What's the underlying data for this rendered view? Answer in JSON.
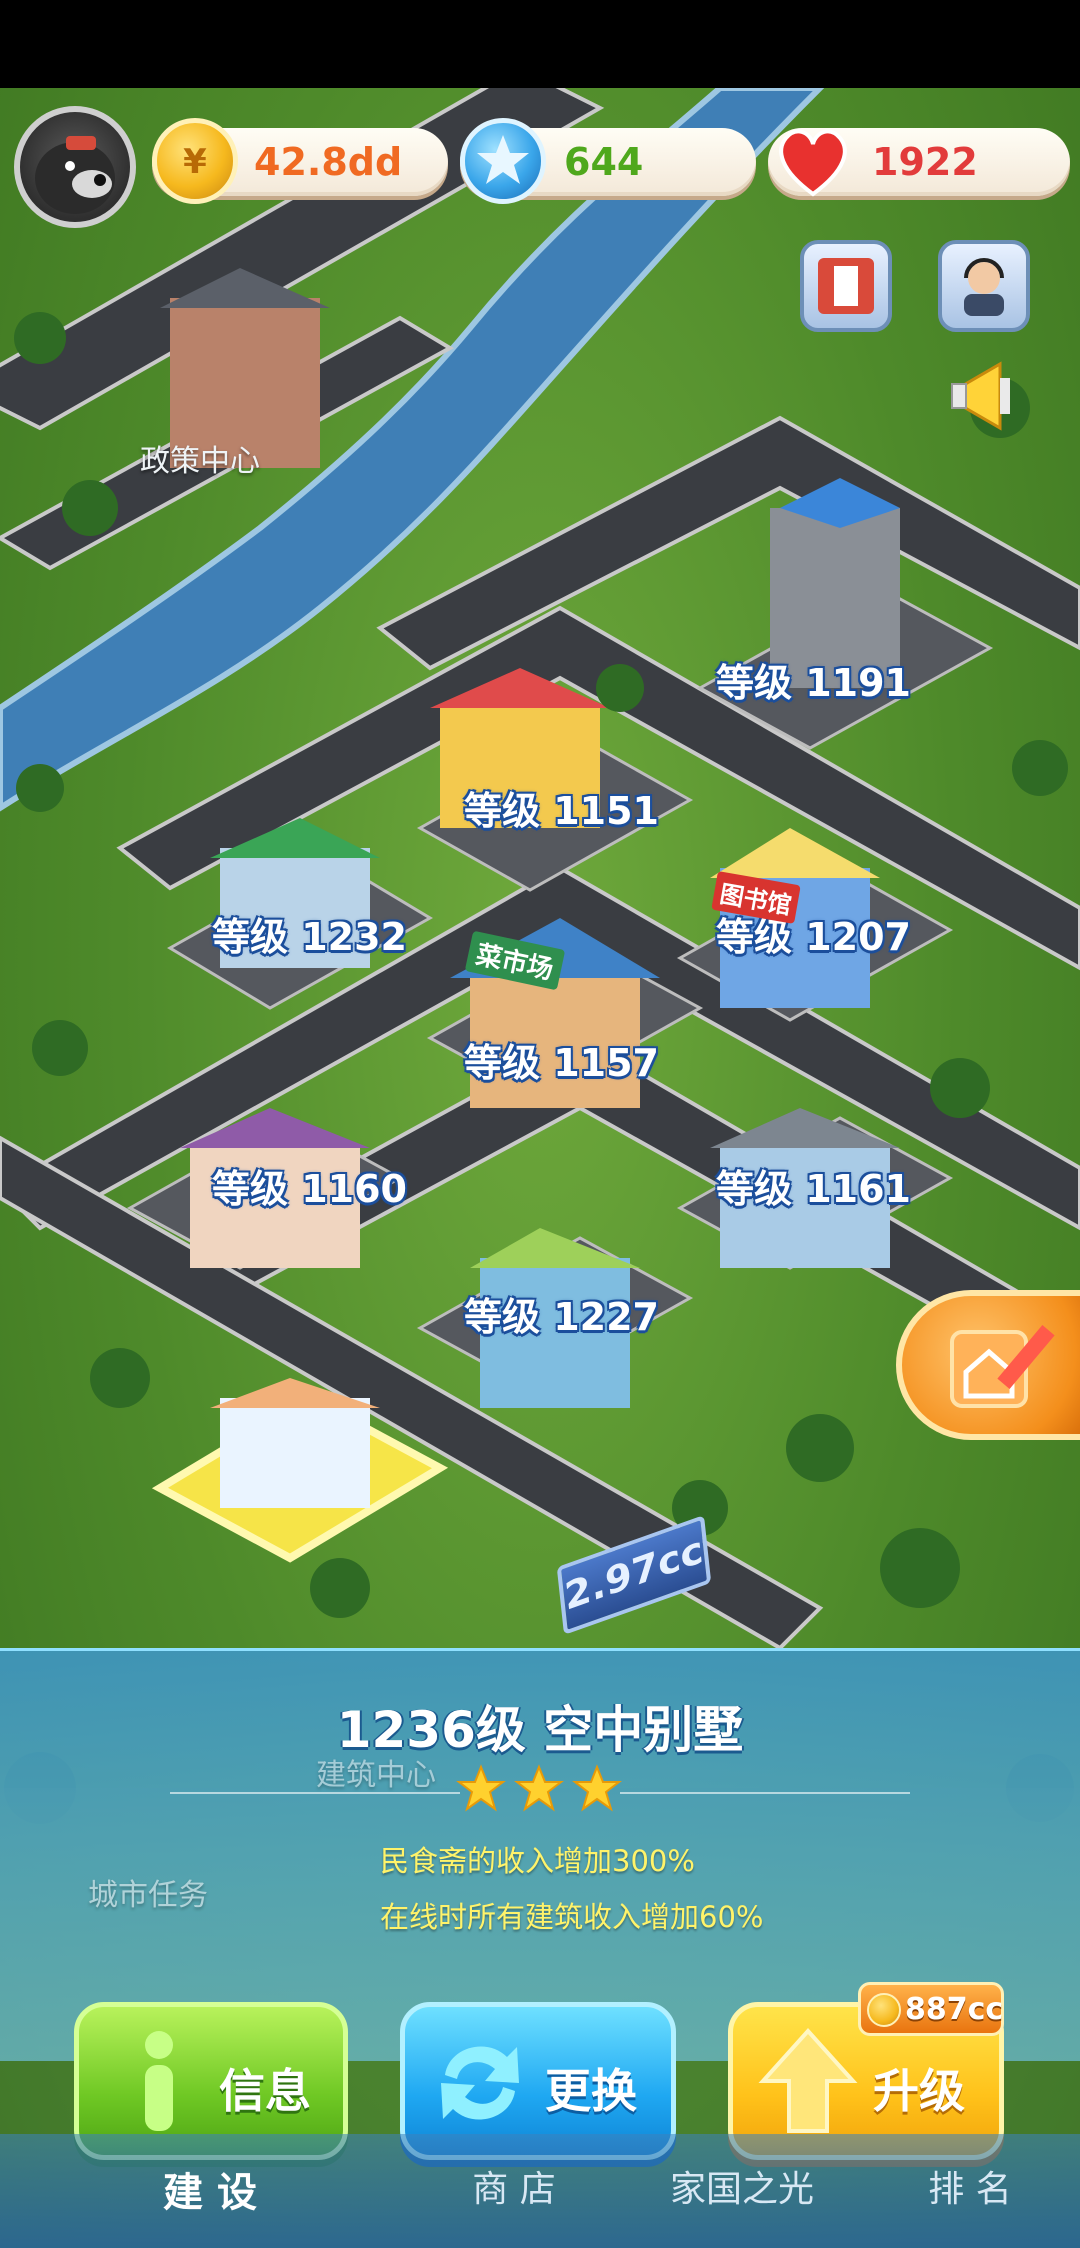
{
  "resources": {
    "coins": "42.8dd",
    "gems": "644",
    "hearts": "1922"
  },
  "map_labels": {
    "policy_center": "政策中心",
    "building_center": "建筑中心",
    "city_tasks": "城市任务"
  },
  "billboard_value": "2.97cc",
  "buildings": [
    {
      "label": "等级 1191"
    },
    {
      "label": "等级 1151"
    },
    {
      "label": "等级 1232"
    },
    {
      "label": "等级 1207"
    },
    {
      "label": "等级 1157"
    },
    {
      "label": "等级 1160"
    },
    {
      "label": "等级 1161"
    },
    {
      "label": "等级 1227"
    }
  ],
  "shop_sign": "菜市场",
  "library_sign": "图书馆",
  "panel": {
    "title": "1236级 空中别墅",
    "stars": 3,
    "effects": [
      "民食斋的收入增加300%",
      "在线时所有建筑收入增加60%"
    ]
  },
  "actions": {
    "info": "信息",
    "swap": "更换",
    "upgrade": "升级",
    "upgrade_cost": "887cc"
  },
  "nav": [
    {
      "label": "建 设",
      "active": true
    },
    {
      "label": "商 店",
      "active": false
    },
    {
      "label": "家国之光",
      "active": false
    },
    {
      "label": "排 名",
      "active": false
    }
  ],
  "colors": {
    "level_text_outline": "#1c4f9c",
    "coin_text": "#f06a22",
    "gem_text": "#4fa81c",
    "heart_text": "#e23b3b",
    "effect_text": "#fff36a"
  }
}
